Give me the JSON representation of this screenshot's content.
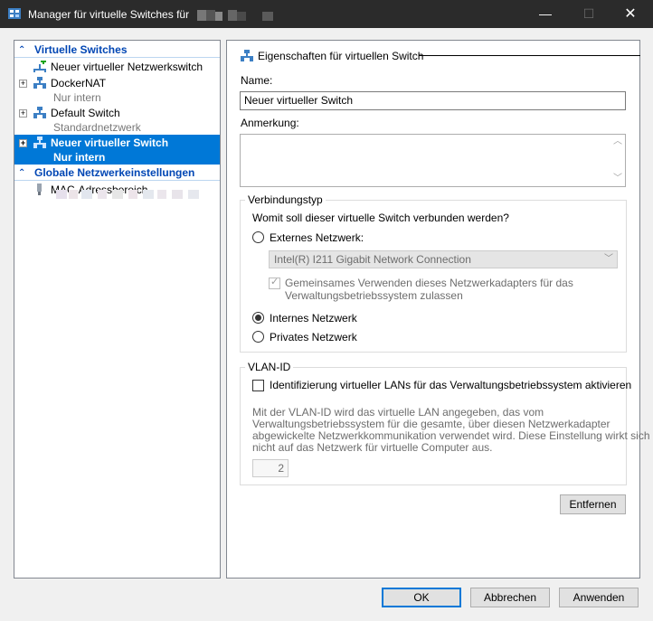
{
  "window": {
    "title": "Manager für virtuelle Switches für",
    "minimize_glyph": "—",
    "maximize_glyph": "☐",
    "close_glyph": "✕"
  },
  "tree": {
    "section_switches": "Virtuelle Switches",
    "new_switch": "Neuer virtueller Netzwerkswitch",
    "items": [
      {
        "label": "DockerNAT",
        "sub": "Nur intern"
      },
      {
        "label": "Default Switch",
        "sub": "Standardnetzwerk"
      },
      {
        "label": "Neuer virtueller Switch",
        "sub": "Nur intern"
      }
    ],
    "section_global": "Globale Netzwerkeinstellungen",
    "mac_label": "MAC-Adressbereich",
    "expander_glyph": "+",
    "chevron_glyph": "⌃"
  },
  "properties": {
    "header": "Eigenschaften für virtuellen Switch",
    "name_label": "Name:",
    "name_value": "Neuer virtueller Switch",
    "note_label": "Anmerkung:",
    "note_value": "",
    "conn_group": "Verbindungstyp",
    "conn_question": "Womit soll dieser virtuelle Switch verbunden werden?",
    "external_label": "Externes Netzwerk:",
    "adapter_value": "Intel(R) I211 Gigabit Network Connection",
    "share_line1": "Gemeinsames Verwenden dieses Netzwerkadapters für das",
    "share_line2": "Verwaltungsbetriebssystem zulassen",
    "internal_label": "Internes Netzwerk",
    "private_label": "Privates Netzwerk",
    "selected_connection": "internal",
    "vlan_group": "VLAN-ID",
    "vlan_check_label": "Identifizierung virtueller LANs für das Verwaltungsbetriebssystem aktivieren",
    "vlan_desc_1": "Mit der VLAN-ID wird das virtuelle LAN angegeben, das vom",
    "vlan_desc_2": "Verwaltungsbetriebssystem für die gesamte, über diesen Netzwerkadapter",
    "vlan_desc_3": "abgewickelte Netzwerkkommunikation verwendet wird. Diese Einstellung wirkt sich",
    "vlan_desc_4": "nicht auf das Netzwerk für virtuelle Computer aus.",
    "vlan_value": "2",
    "remove_button": "Entfernen"
  },
  "footer": {
    "ok": "OK",
    "cancel": "Abbrechen",
    "apply": "Anwenden"
  },
  "colors": {
    "accent": "#0078d7",
    "titlebar": "#2b2b2b",
    "section_head": "#0046b4"
  }
}
